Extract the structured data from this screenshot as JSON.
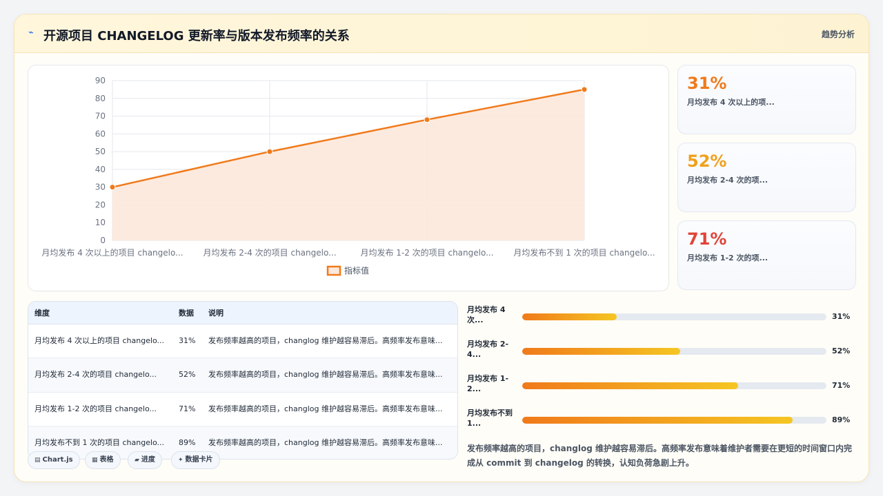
{
  "header": {
    "icon": "sparkle-icon",
    "title": "开源项目 CHANGELOG 更新率与版本发布频率的关系",
    "tag": "趋势分析"
  },
  "chart_data": {
    "type": "line",
    "categories": [
      "月均发布 4 次以上的项目 changelo...",
      "月均发布 2-4 次的项目 changelo...",
      "月均发布 1-2 次的项目 changelo...",
      "月均发布不到 1 次的项目 changelo..."
    ],
    "series": [
      {
        "name": "指标值",
        "values": [
          30,
          50,
          68,
          85
        ],
        "color": "#f07a1b",
        "fill": "#fde8dc"
      }
    ],
    "ylim": [
      0,
      90
    ],
    "yticks": [
      "0",
      "10",
      "20",
      "30",
      "40",
      "50",
      "60",
      "70",
      "80",
      "90"
    ],
    "grid": true,
    "legend": "bottom"
  },
  "stats": [
    {
      "value": "31%",
      "label": "月均发布 4 次以上的项...",
      "color": "#f07a1b"
    },
    {
      "value": "52%",
      "label": "月均发布 2-4 次的项...",
      "color": "#f0a11b"
    },
    {
      "value": "71%",
      "label": "月均发布 1-2 次的项...",
      "color": "#e0443a"
    }
  ],
  "table": {
    "headers": [
      "维度",
      "数据",
      "说明"
    ],
    "rows": [
      {
        "dim": "月均发布 4 次以上的项目 changelo...",
        "val": "31%",
        "desc": "发布频率越高的项目，changlog 维护越容易滞后。高频率发布意味..."
      },
      {
        "dim": "月均发布 2-4 次的项目 changelo...",
        "val": "52%",
        "desc": "发布频率越高的项目，changlog 维护越容易滞后。高频率发布意味..."
      },
      {
        "dim": "月均发布 1-2 次的项目 changelo...",
        "val": "71%",
        "desc": "发布频率越高的项目，changlog 维护越容易滞后。高频率发布意味..."
      },
      {
        "dim": "月均发布不到 1 次的项目 changelo...",
        "val": "89%",
        "desc": "发布频率越高的项目，changlog 维护越容易滞后。高频率发布意味..."
      }
    ]
  },
  "tabs": [
    {
      "icon": "chart-icon",
      "glyph": "▤",
      "label": "Chart.js"
    },
    {
      "icon": "table-icon",
      "glyph": "▦",
      "label": "表格"
    },
    {
      "icon": "progress-icon",
      "glyph": "▰",
      "label": "进度"
    },
    {
      "icon": "card-icon",
      "glyph": "✦",
      "label": "数据卡片"
    }
  ],
  "progress": [
    {
      "name": "月均发布 4 次...",
      "pct": "31%",
      "value": 31
    },
    {
      "name": "月均发布 2-4...",
      "pct": "52%",
      "value": 52
    },
    {
      "name": "月均发布 1-2...",
      "pct": "71%",
      "value": 71
    },
    {
      "name": "月均发布不到 1...",
      "pct": "89%",
      "value": 89
    }
  ],
  "note": "发布频率越高的项目，changlog 维护越容易滞后。高频率发布意味着维护者需要在更短的时间窗口内完成从 commit 到 changelog 的转换，认知负荷急剧上升。"
}
